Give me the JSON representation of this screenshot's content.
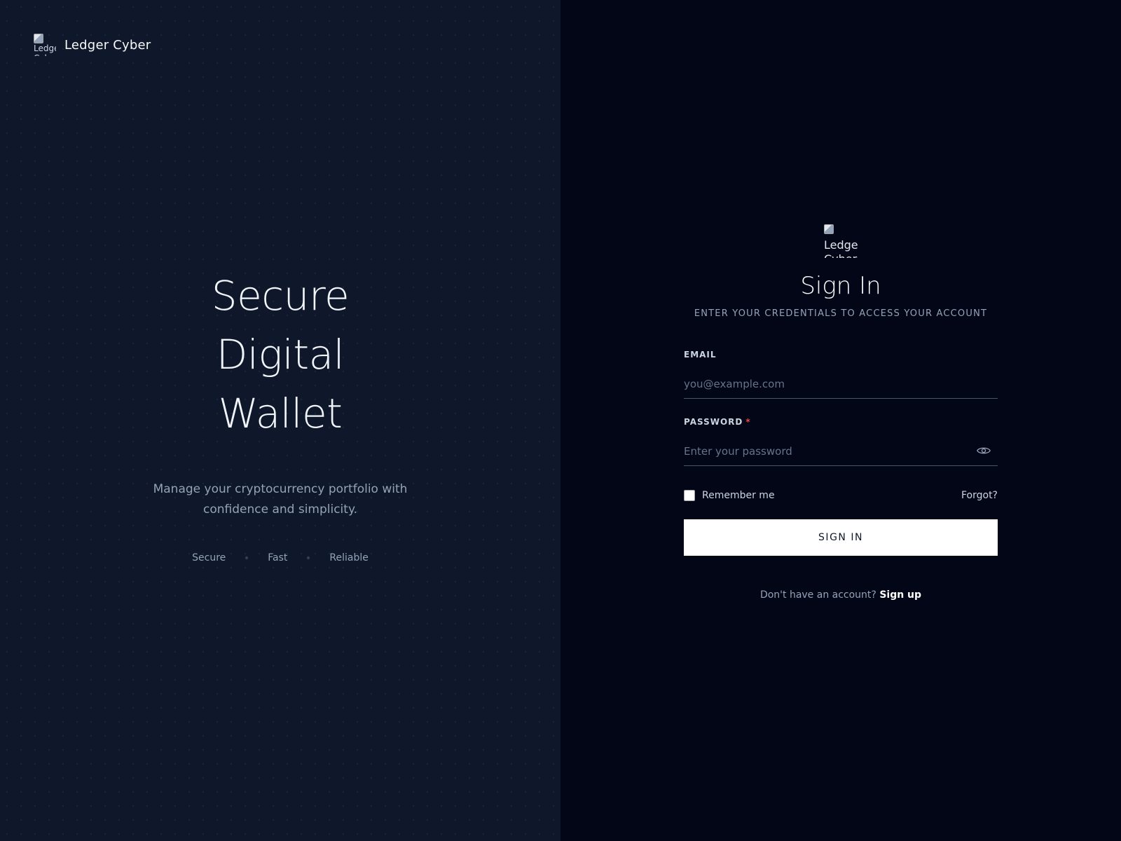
{
  "brand": {
    "logo_alt": "Ledger Cyber",
    "name": "Ledger Cyber"
  },
  "hero": {
    "lines": [
      "Secure",
      "Digital",
      "Wallet"
    ],
    "subtitle": "Manage your cryptocurrency portfolio with confidence and simplicity.",
    "features": [
      "Secure",
      "Fast",
      "Reliable"
    ]
  },
  "form": {
    "logo_alt": "Ledger Cyber",
    "title": "Sign In",
    "subtitle": "ENTER YOUR CREDENTIALS TO ACCESS YOUR ACCOUNT",
    "email": {
      "label": "EMAIL",
      "placeholder": "you@example.com",
      "value": ""
    },
    "password": {
      "label": "PASSWORD",
      "required_mark": "*",
      "placeholder": "Enter your password",
      "value": ""
    },
    "remember_label": "Remember me",
    "forgot_label": "Forgot?",
    "submit_label": "SIGN IN",
    "signup_prompt": "Don't have an account?",
    "signup_link": "Sign up"
  },
  "colors": {
    "left_bg": "#0f172a",
    "right_bg": "#030616",
    "accent": "#ffffff",
    "required": "#ef4444"
  },
  "icons": {
    "eye": "eye-icon",
    "broken_image": "broken-image-icon"
  }
}
